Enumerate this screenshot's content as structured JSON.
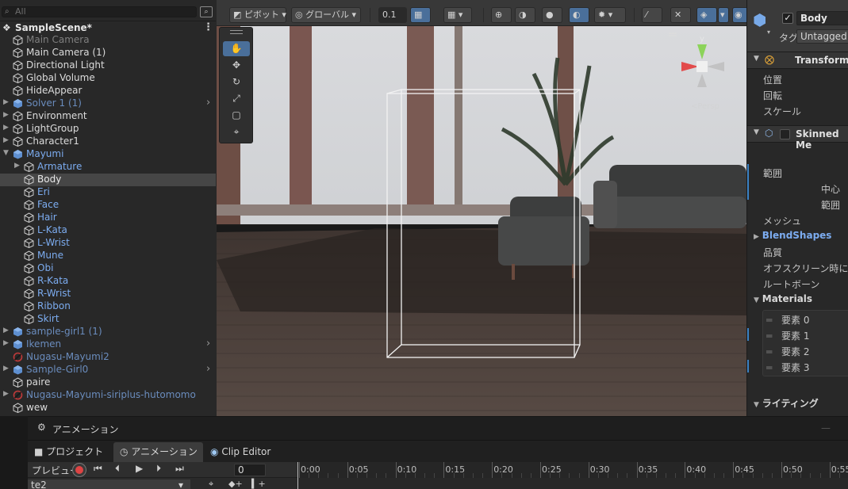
{
  "hierarchy": {
    "search_placeholder": "All",
    "scene_name": "SampleScene*",
    "items": [
      {
        "label": "Main Camera",
        "indent": 0,
        "arrow": false,
        "kind": "go",
        "color": "dim"
      },
      {
        "label": "Main Camera (1)",
        "indent": 0,
        "arrow": false,
        "kind": "go",
        "color": "white"
      },
      {
        "label": "Directional Light",
        "indent": 0,
        "arrow": false,
        "kind": "go",
        "color": "white"
      },
      {
        "label": "Global Volume",
        "indent": 0,
        "arrow": false,
        "kind": "go",
        "color": "white"
      },
      {
        "label": "HideAppear",
        "indent": 0,
        "arrow": false,
        "kind": "go",
        "color": "white"
      },
      {
        "label": "Solver 1 (1)",
        "indent": 0,
        "arrow": true,
        "kind": "prefab",
        "color": "pblue",
        "more": true
      },
      {
        "label": "Environment",
        "indent": 0,
        "arrow": true,
        "kind": "go",
        "color": "white"
      },
      {
        "label": "LightGroup",
        "indent": 0,
        "arrow": true,
        "kind": "go",
        "color": "white"
      },
      {
        "label": "Character1",
        "indent": 0,
        "arrow": true,
        "kind": "go",
        "color": "white"
      },
      {
        "label": "Mayumi",
        "indent": 0,
        "arrow": true,
        "open": true,
        "kind": "prefab",
        "color": "blue"
      },
      {
        "label": "Armature",
        "indent": 1,
        "arrow": true,
        "kind": "go",
        "color": "blue"
      },
      {
        "label": "Body",
        "indent": 1,
        "arrow": false,
        "kind": "go",
        "color": "sel",
        "selected": true
      },
      {
        "label": "Eri",
        "indent": 1,
        "arrow": false,
        "kind": "go",
        "color": "blue"
      },
      {
        "label": "Face",
        "indent": 1,
        "arrow": false,
        "kind": "go",
        "color": "blue"
      },
      {
        "label": "Hair",
        "indent": 1,
        "arrow": false,
        "kind": "go",
        "color": "blue"
      },
      {
        "label": "L-Kata",
        "indent": 1,
        "arrow": false,
        "kind": "go",
        "color": "blue"
      },
      {
        "label": "L-Wrist",
        "indent": 1,
        "arrow": false,
        "kind": "go",
        "color": "blue"
      },
      {
        "label": "Mune",
        "indent": 1,
        "arrow": false,
        "kind": "go",
        "color": "blue"
      },
      {
        "label": "Obi",
        "indent": 1,
        "arrow": false,
        "kind": "go",
        "color": "blue"
      },
      {
        "label": "R-Kata",
        "indent": 1,
        "arrow": false,
        "kind": "go",
        "color": "blue"
      },
      {
        "label": "R-Wrist",
        "indent": 1,
        "arrow": false,
        "kind": "go",
        "color": "blue"
      },
      {
        "label": "Ribbon",
        "indent": 1,
        "arrow": false,
        "kind": "go",
        "color": "blue"
      },
      {
        "label": "Skirt",
        "indent": 1,
        "arrow": false,
        "kind": "go",
        "color": "blue"
      },
      {
        "label": "sample-girl1 (1)",
        "indent": 0,
        "arrow": true,
        "kind": "prefab",
        "color": "pblue"
      },
      {
        "label": "Ikemen",
        "indent": 0,
        "arrow": true,
        "kind": "prefab",
        "color": "pblue",
        "more": true
      },
      {
        "label": "Nugasu-Mayumi2",
        "indent": 0,
        "arrow": false,
        "kind": "missing",
        "color": "pblue"
      },
      {
        "label": "Sample-Girl0",
        "indent": 0,
        "arrow": true,
        "kind": "prefab",
        "color": "pblue",
        "more": true
      },
      {
        "label": "paire",
        "indent": 0,
        "arrow": false,
        "kind": "go",
        "color": "white"
      },
      {
        "label": "Nugasu-Mayumi-siriplus-hutomomo",
        "indent": 0,
        "arrow": true,
        "kind": "missing",
        "color": "pblue"
      },
      {
        "label": "wew",
        "indent": 0,
        "arrow": false,
        "kind": "go",
        "color": "white"
      }
    ]
  },
  "toolbar": {
    "pivot_label": "ピボット",
    "global_label": "グローバル",
    "snap_value": "0.1"
  },
  "scene": {
    "persp_label": "<Persp",
    "axis_y": "y"
  },
  "inspector": {
    "object_name": "Body",
    "tag_label": "タグ",
    "tag_value": "Untagged",
    "transform_title": "Transform",
    "position_label": "位置",
    "rotation_label": "回転",
    "scale_label": "スケール",
    "skinned_title": "Skinned Me",
    "bounds_label": "範囲",
    "center_label": "中心",
    "extent_label": "範囲",
    "mesh_label": "メッシュ",
    "blendshapes_label": "BlendShapes",
    "quality_label": "品質",
    "offscreen_label": "オフスクリーン時に更新",
    "rootbone_label": "ルートボーン",
    "materials_label": "Materials",
    "elements": [
      "要素 0",
      "要素 1",
      "要素 2",
      "要素 3"
    ],
    "lighting_label": "ライティング"
  },
  "animation": {
    "window_title": "アニメーション",
    "tabs": [
      "プロジェクト",
      "アニメーション",
      "Clip Editor"
    ],
    "preview_label": "プレビュー",
    "frame_value": "0",
    "clip_name": "te2",
    "ticks": [
      "0:00",
      "0:05",
      "0:10",
      "0:15",
      "0:20",
      "0:25",
      "0:30",
      "0:35",
      "0:40",
      "0:45",
      "0:50",
      "0:55"
    ]
  }
}
